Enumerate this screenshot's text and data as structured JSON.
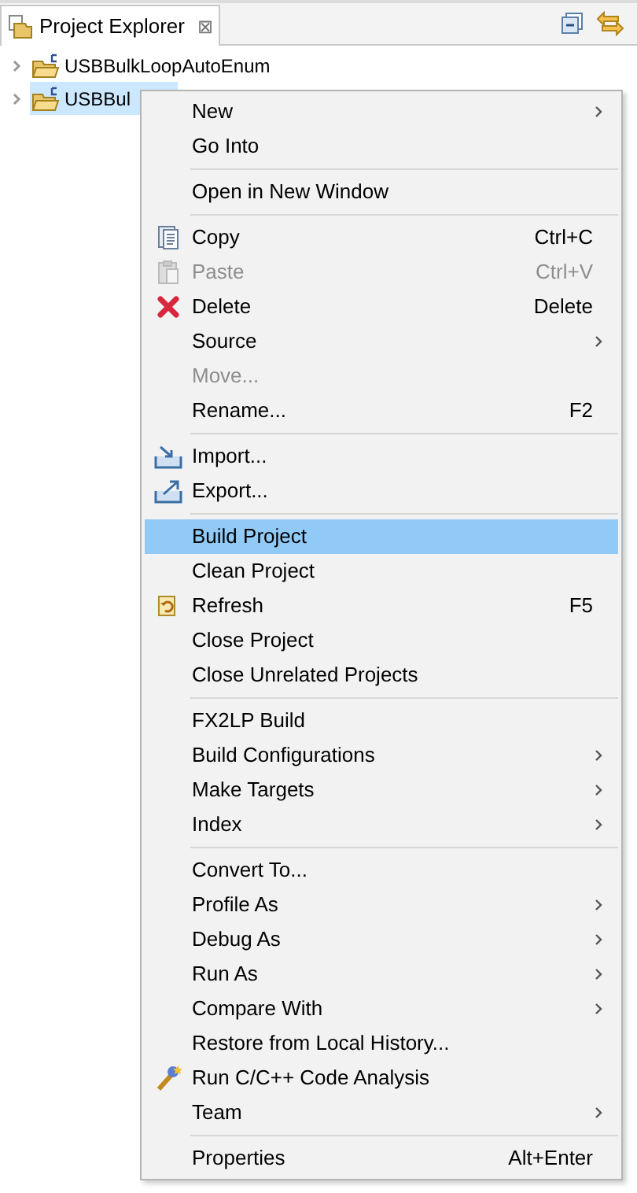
{
  "view_tab": {
    "title": "Project Explorer",
    "close": "⊠"
  },
  "tree": [
    {
      "label": "USBBulkLoopAutoEnum",
      "selected": false
    },
    {
      "label": "USBBul",
      "selected": true
    }
  ],
  "context_menu": {
    "groups": [
      [
        {
          "label": "New",
          "submenu": true,
          "disabled": false,
          "selected": false
        },
        {
          "label": "Go Into",
          "submenu": false,
          "disabled": false,
          "selected": false
        }
      ],
      [
        {
          "label": "Open in New Window",
          "submenu": false,
          "disabled": false,
          "selected": false
        }
      ],
      [
        {
          "label": "Copy",
          "shortcut": "Ctrl+C",
          "kind": "copy",
          "submenu": false,
          "disabled": false,
          "selected": false
        },
        {
          "label": "Paste",
          "shortcut": "Ctrl+V",
          "kind": "paste",
          "submenu": false,
          "disabled": true,
          "selected": false
        },
        {
          "label": "Delete",
          "shortcut": "Delete",
          "kind": "delete",
          "submenu": false,
          "disabled": false,
          "selected": false
        },
        {
          "label": "Source",
          "submenu": true,
          "disabled": false,
          "selected": false
        },
        {
          "label": "Move...",
          "submenu": false,
          "disabled": true,
          "selected": false
        },
        {
          "label": "Rename...",
          "shortcut": "F2",
          "submenu": false,
          "disabled": false,
          "selected": false
        }
      ],
      [
        {
          "label": "Import...",
          "kind": "import",
          "submenu": false,
          "disabled": false,
          "selected": false
        },
        {
          "label": "Export...",
          "kind": "export",
          "submenu": false,
          "disabled": false,
          "selected": false
        }
      ],
      [
        {
          "label": "Build Project",
          "submenu": false,
          "disabled": false,
          "selected": true
        },
        {
          "label": "Clean Project",
          "submenu": false,
          "disabled": false,
          "selected": false
        },
        {
          "label": "Refresh",
          "shortcut": "F5",
          "kind": "refresh",
          "submenu": false,
          "disabled": false,
          "selected": false
        },
        {
          "label": "Close Project",
          "submenu": false,
          "disabled": false,
          "selected": false
        },
        {
          "label": "Close Unrelated Projects",
          "submenu": false,
          "disabled": false,
          "selected": false
        }
      ],
      [
        {
          "label": "FX2LP Build",
          "submenu": false,
          "disabled": false,
          "selected": false
        },
        {
          "label": "Build Configurations",
          "submenu": true,
          "disabled": false,
          "selected": false
        },
        {
          "label": "Make Targets",
          "submenu": true,
          "disabled": false,
          "selected": false
        },
        {
          "label": "Index",
          "submenu": true,
          "disabled": false,
          "selected": false
        }
      ],
      [
        {
          "label": "Convert To...",
          "submenu": false,
          "disabled": false,
          "selected": false
        },
        {
          "label": "Profile As",
          "submenu": true,
          "disabled": false,
          "selected": false
        },
        {
          "label": "Debug As",
          "submenu": true,
          "disabled": false,
          "selected": false
        },
        {
          "label": "Run As",
          "submenu": true,
          "disabled": false,
          "selected": false
        },
        {
          "label": "Compare With",
          "submenu": true,
          "disabled": false,
          "selected": false
        },
        {
          "label": "Restore from Local History...",
          "submenu": false,
          "disabled": false,
          "selected": false
        },
        {
          "label": "Run C/C++ Code Analysis",
          "kind": "analysis",
          "submenu": false,
          "disabled": false,
          "selected": false
        },
        {
          "label": "Team",
          "submenu": true,
          "disabled": false,
          "selected": false
        }
      ],
      [
        {
          "label": "Properties",
          "shortcut": "Alt+Enter",
          "submenu": false,
          "disabled": false,
          "selected": false
        }
      ]
    ]
  }
}
